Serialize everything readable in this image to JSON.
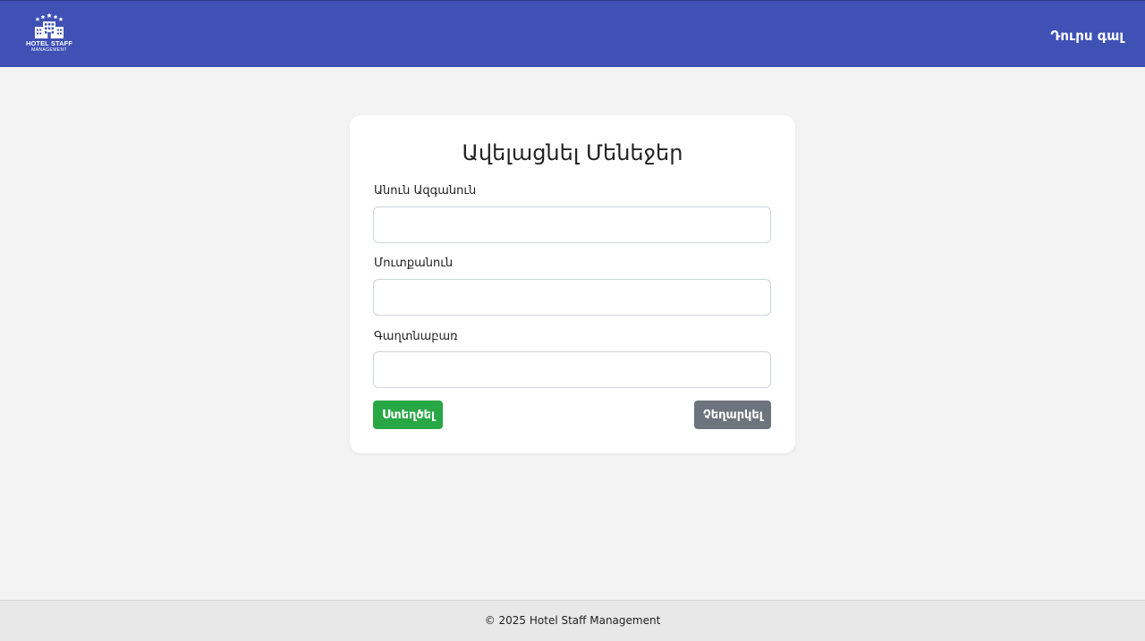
{
  "header": {
    "logo_line1": "HOTEL STAFF",
    "logo_line2": "MANAGEMENT",
    "logout_label": "Դուրս գալ"
  },
  "form": {
    "title": "Ավելացնել Մենեջեր",
    "fields": [
      {
        "label": "Անուն Ազգանուն",
        "value": ""
      },
      {
        "label": "Մուտքանուն",
        "value": ""
      },
      {
        "label": "Գաղտնաբառ",
        "value": ""
      }
    ],
    "submit_label": "Ստեղծել",
    "cancel_label": "Չեղարկել"
  },
  "footer": {
    "text": "© 2025 Hotel Staff Management"
  },
  "colors": {
    "header_bg": "#3f51b5",
    "submit_bg": "#28a745",
    "cancel_bg": "#6c757d",
    "page_bg": "#f3f3f3"
  },
  "icons": {
    "logo": "hotel-building-icon"
  }
}
